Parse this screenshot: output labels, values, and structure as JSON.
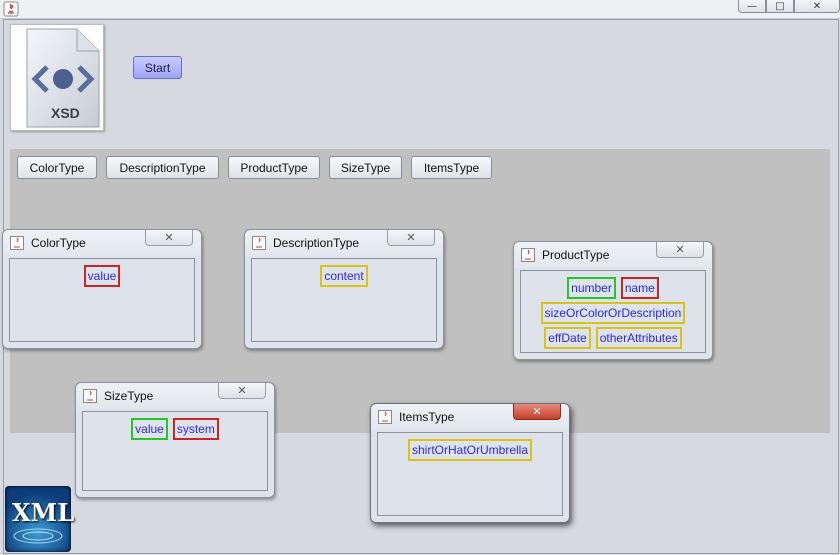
{
  "window": {
    "minimize_glyph": "—",
    "maximize_glyph": "□",
    "close_glyph": "✕"
  },
  "toolbar": {
    "start_label": "Start"
  },
  "logos": {
    "xsd_text": "XSD",
    "xml_text": "XML"
  },
  "type_buttons": [
    "ColorType",
    "DescriptionType",
    "ProductType",
    "SizeType",
    "ItemsType"
  ],
  "frames": {
    "color": {
      "title": "ColorType",
      "fields": [
        "value"
      ]
    },
    "description": {
      "title": "DescriptionType",
      "fields": [
        "content"
      ]
    },
    "product": {
      "title": "ProductType",
      "fields": [
        "number",
        "name",
        "sizeOrColorOrDescription",
        "effDate",
        "otherAttributes"
      ]
    },
    "size": {
      "title": "SizeType",
      "fields": [
        "value",
        "system"
      ]
    },
    "items": {
      "title": "ItemsType",
      "fields": [
        "shirtOrHatOrUmbrella"
      ]
    }
  },
  "close_glyph": "✕",
  "colors": {
    "required_border": "#c4262a",
    "attribute_border": "#28c428",
    "optional_border": "#d6c416",
    "field_text": "#2b2bd0",
    "panel_bg": "#c0c0c0"
  }
}
